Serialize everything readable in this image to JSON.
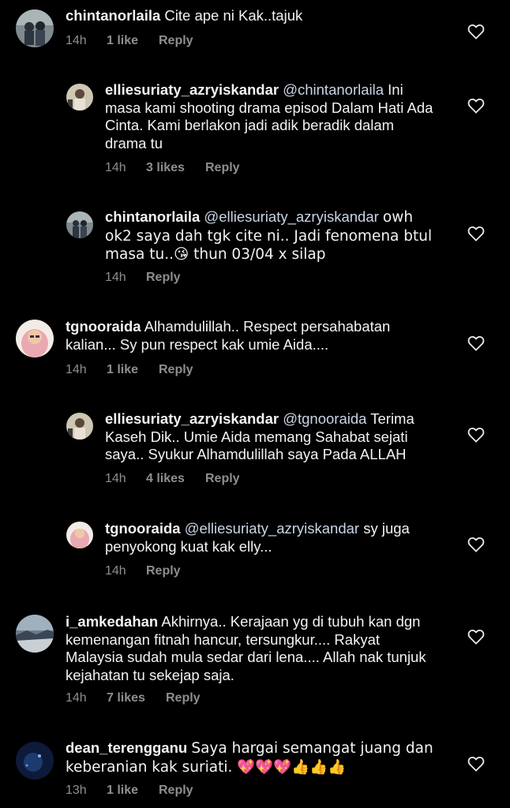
{
  "reply_label": "Reply",
  "comments": [
    {
      "user": "chintanorlaila",
      "mention": "",
      "text": "Cite ape ni Kak..tajuk",
      "time": "14h",
      "likes": "1 like"
    },
    {
      "user": "elliesuriaty_azryiskandar",
      "mention": "@chintanorlaila",
      "text": "Ini masa kami shooting drama episod Dalam Hati Ada Cinta. Kami berlakon jadi adik beradik dalam drama tu",
      "time": "14h",
      "likes": "3 likes"
    },
    {
      "user": "chintanorlaila",
      "mention": "@elliesuriaty_azryiskandar",
      "text": "owh ok2 saya dah tgk cite ni.. Jadi fenomena btul masa tu..😘 thun 03/04 x silap",
      "time": "14h",
      "likes": ""
    },
    {
      "user": "tgnooraida",
      "mention": "",
      "text": "Alhamdulillah.. Respect persahabatan kalian... Sy pun respect kak umie Aida....",
      "time": "14h",
      "likes": "1 like"
    },
    {
      "user": "elliesuriaty_azryiskandar",
      "mention": "@tgnooraida",
      "text": "Terima Kaseh Dik.. Umie Aida memang Sahabat sejati saya.. Syukur Alhamdulillah saya Pada ALLAH",
      "time": "14h",
      "likes": "4 likes"
    },
    {
      "user": "tgnooraida",
      "mention": "@elliesuriaty_azryiskandar",
      "text": "sy juga penyokong kuat  kak elly...",
      "time": "14h",
      "likes": ""
    },
    {
      "user": "i_amkedahan",
      "mention": "",
      "text": "Akhirnya.. Kerajaan yg di tubuh kan dgn kemenangan fitnah hancur, tersungkur.... Rakyat Malaysia sudah mula sedar dari lena.... Allah nak tunjuk kejahatan tu sekejap saja.",
      "time": "14h",
      "likes": "7 likes"
    },
    {
      "user": "dean_terengganu",
      "mention": "",
      "text": "Saya hargai semangat juang dan keberanian kak suriati. 💖💖💖👍👍👍",
      "time": "13h",
      "likes": "1 like"
    }
  ]
}
